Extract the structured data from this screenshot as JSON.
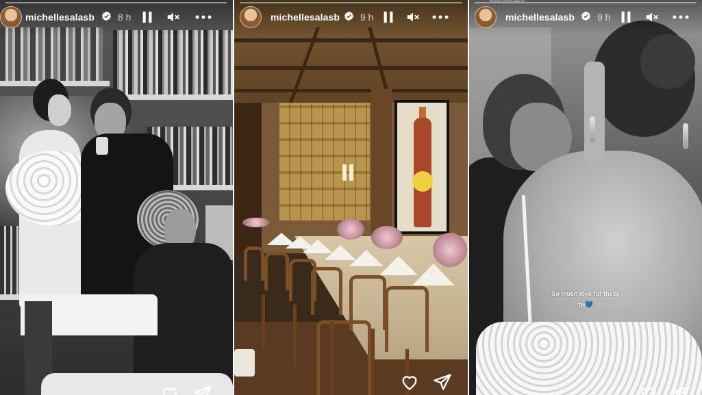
{
  "stories": [
    {
      "username": "michellesalasb",
      "timestamp": "8 h",
      "verified": true,
      "paused": true,
      "muted": true
    },
    {
      "username": "michellesalasb",
      "timestamp": "9 h",
      "verified": true,
      "paused": true,
      "muted": true
    },
    {
      "username": "michellesalasb",
      "timestamp": "9 h",
      "verified": true,
      "paused": true,
      "muted": true,
      "caption_line1": "So much love for these",
      "caption_line2": "tw💙",
      "top_partial_text": "kaeoacam"
    }
  ],
  "actions": {
    "like_icon": "heart-icon",
    "share_icon": "send-icon",
    "more_icon": "more-options-icon"
  },
  "colors": {
    "overlay_text": "#ffffff",
    "verified_badge": "#ffffff"
  }
}
